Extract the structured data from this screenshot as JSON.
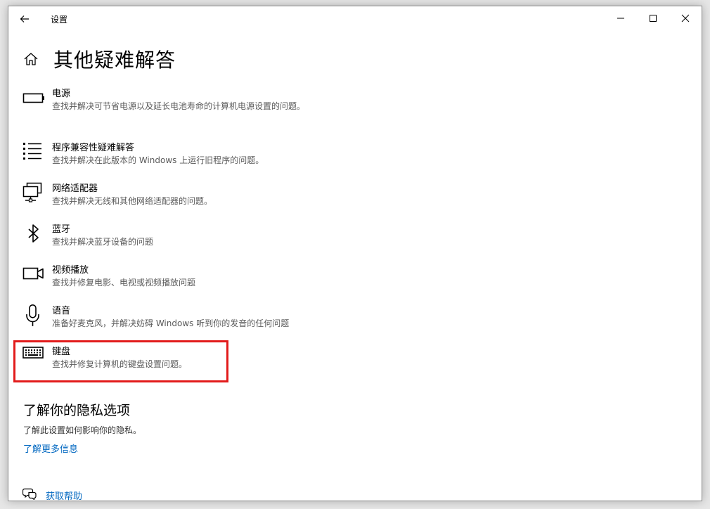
{
  "window": {
    "title": "设置"
  },
  "header": {
    "title": "其他疑难解答"
  },
  "items": [
    {
      "name": "电源",
      "desc": "查找并解决可节省电源以及延长电池寿命的计算机电源设置的问题。",
      "icon": "battery-icon"
    },
    {
      "name": "程序兼容性疑难解答",
      "desc": "查找并解决在此版本的 Windows 上运行旧程序的问题。",
      "icon": "list-icon"
    },
    {
      "name": "网络适配器",
      "desc": "查找并解决无线和其他网络适配器的问题。",
      "icon": "network-adapter-icon"
    },
    {
      "name": "蓝牙",
      "desc": "查找并解决蓝牙设备的问题",
      "icon": "bluetooth-icon"
    },
    {
      "name": "视频播放",
      "desc": "查找并修复电影、电视或视频播放问题",
      "icon": "video-camera-icon"
    },
    {
      "name": "语音",
      "desc": "准备好麦克风，并解决妨碍 Windows 听到你的发音的任何问题",
      "icon": "microphone-icon"
    },
    {
      "name": "键盘",
      "desc": "查找并修复计算机的键盘设置问题。",
      "icon": "keyboard-icon"
    }
  ],
  "privacy": {
    "title": "了解你的隐私选项",
    "desc": "了解此设置如何影响你的隐私。",
    "link": "了解更多信息"
  },
  "help": {
    "label": "获取帮助"
  },
  "colors": {
    "highlight": "#e21b1b",
    "link": "#0067c0"
  }
}
